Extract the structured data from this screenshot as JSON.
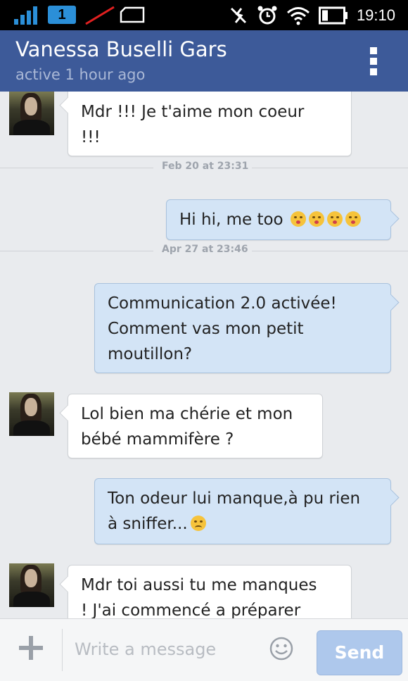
{
  "status_bar": {
    "sim_slot": "1",
    "time": "19:10"
  },
  "header": {
    "contact_name": "Vanessa Buselli Gars",
    "presence": "active 1 hour ago"
  },
  "messages": [
    {
      "direction": "incoming",
      "lines": [
        "Mdr !!! Je t'aime mon coeur",
        "!!!"
      ]
    },
    {
      "direction": "outgoing",
      "lines": [
        "Hi hi, me too"
      ],
      "emoji": [
        "kiss",
        "kiss",
        "kiss",
        "kiss"
      ]
    },
    {
      "direction": "outgoing",
      "lines": [
        "Communication 2.0 activée!",
        "Comment vas mon petit",
        "moutillon?"
      ]
    },
    {
      "direction": "incoming",
      "lines": [
        "Lol bien ma chérie et mon",
        "bébé mammifère ?"
      ]
    },
    {
      "direction": "outgoing",
      "lines": [
        "Ton odeur lui manque,à pu rien",
        "à sniffer..."
      ],
      "emoji": [
        "sad"
      ]
    },
    {
      "direction": "incoming",
      "lines": [
        "Mdr toi aussi tu me manques",
        "! J'ai commencé a préparer"
      ]
    }
  ],
  "dividers": [
    {
      "label": "Feb 20 at 23:31"
    },
    {
      "label": "Apr 27 at 23:46"
    }
  ],
  "composer": {
    "placeholder": "Write a message",
    "send_label": "Send"
  },
  "colors": {
    "header_bg": "#3d5a99",
    "outgoing_bubble": "#d3e4f6",
    "incoming_bubble": "#ffffff",
    "send_button": "#aec8ec"
  }
}
